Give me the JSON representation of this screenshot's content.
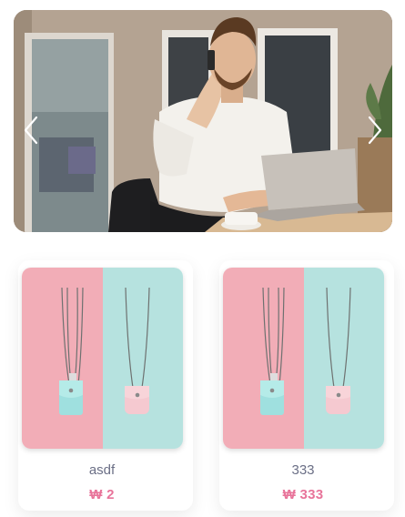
{
  "carousel": {
    "prev_icon": "chevron-left-icon",
    "next_icon": "chevron-right-icon",
    "colors": {
      "wall": "#b8a898",
      "shirt": "#f4f2ee",
      "laptop": "#c9c3bc"
    }
  },
  "products": [
    {
      "name": "asdf",
      "currency": "₩",
      "price": "2"
    },
    {
      "name": "333",
      "currency": "₩",
      "price": "333"
    }
  ],
  "colors": {
    "price": "#e8749a",
    "name": "#6b6f86",
    "pink": "#f2adb7",
    "mint": "#b6e2df"
  }
}
